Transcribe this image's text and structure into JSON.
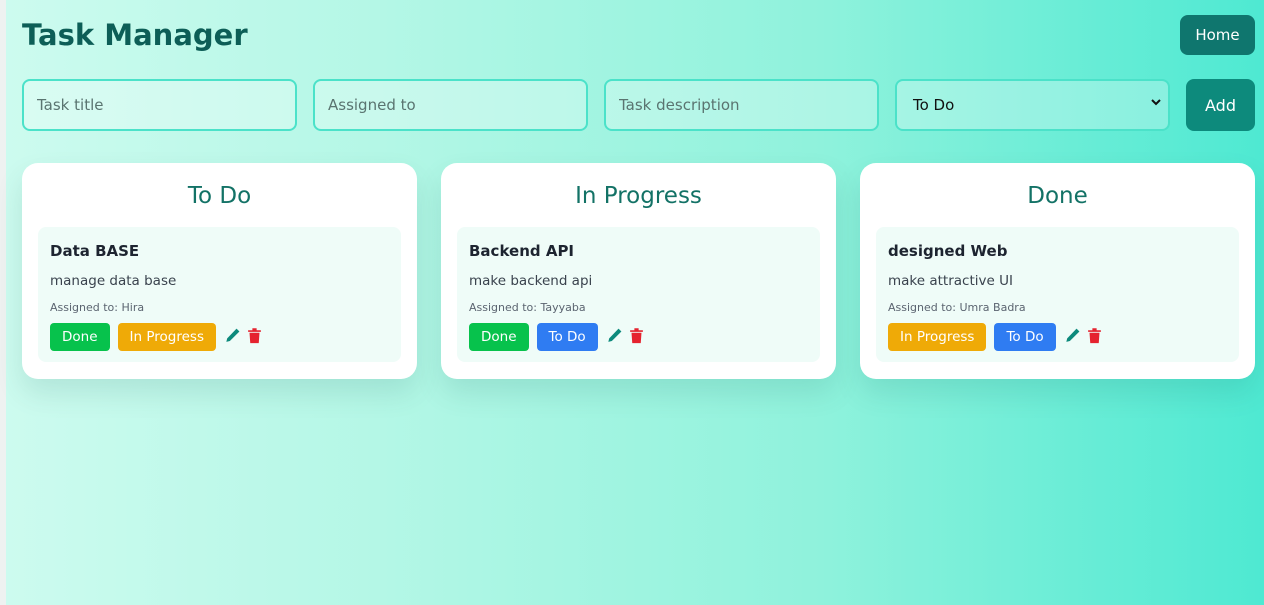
{
  "header": {
    "title": "Task Manager",
    "home_label": "Home"
  },
  "form": {
    "title_placeholder": "Task title",
    "assigned_placeholder": "Assigned to",
    "description_placeholder": "Task description",
    "status_selected": "To Do",
    "add_label": "Add"
  },
  "assigned_prefix": "Assigned to: ",
  "columns": [
    {
      "title": "To Do",
      "task": {
        "title": "Data BASE",
        "description": "manage data base",
        "assignee": "Hira",
        "actions": [
          "Done",
          "In Progress"
        ]
      }
    },
    {
      "title": "In Progress",
      "task": {
        "title": "Backend API",
        "description": "make backend api",
        "assignee": "Tayyaba",
        "actions": [
          "Done",
          "To Do"
        ]
      }
    },
    {
      "title": "Done",
      "task": {
        "title": "designed Web",
        "description": "make attractive UI",
        "assignee": "Umra Badra",
        "actions": [
          "In Progress",
          "To Do"
        ]
      }
    }
  ],
  "icons": {
    "edit": "pencil-icon",
    "delete": "trash-icon",
    "select": "chevron-down-icon"
  },
  "colors": {
    "primary": "#0f766e",
    "done_button": "#07c24c",
    "in_progress_button": "#efaa07",
    "todo_button": "#2f7cf2",
    "edit_icon": "#0d8a7c",
    "delete_icon": "#e5232f"
  }
}
